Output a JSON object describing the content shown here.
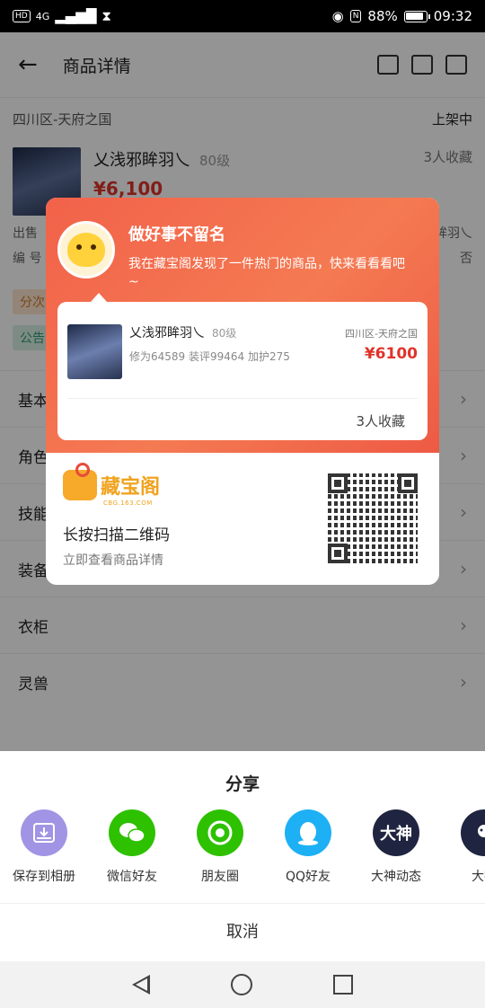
{
  "status_bar": {
    "network": "4G",
    "battery": "88%",
    "time": "09:32"
  },
  "background_page": {
    "title": "商品详情",
    "region": "四川区-天府之国",
    "listing_status": "上架中",
    "item": {
      "name": "乂浅邪眸羽乀",
      "level": "80级",
      "favorites": "3人收藏",
      "price": "¥6,100"
    },
    "info_left": [
      "出售",
      "编  号"
    ],
    "info_right": [
      "眸羽乀",
      "否"
    ],
    "tags": [
      "分次",
      "公告"
    ],
    "sections": [
      "基本",
      "角色",
      "技能",
      "装备物品",
      "衣柜",
      "灵兽"
    ]
  },
  "share_card": {
    "headline": "做好事不留名",
    "message": "我在藏宝阁发现了一件热门的商品，快来看看看吧~",
    "item": {
      "name": "乂浅邪眸羽乀",
      "level": "80级",
      "region": "四川区-天府之国",
      "stats": "修为64589  装评99464  加护275",
      "price": "¥6100",
      "favorites": "3人收藏"
    },
    "brand": "藏宝阁",
    "brand_sub": "CBG.163.COM",
    "scan_text": "长按扫描二维码",
    "scan_sub": "立即查看商品详情"
  },
  "share_sheet": {
    "title": "分享",
    "targets": [
      {
        "label": "保存到相册",
        "icon": "save-album-icon",
        "color": "#9d8fe0"
      },
      {
        "label": "微信好友",
        "icon": "wechat-icon",
        "color": "#2dc100"
      },
      {
        "label": "朋友圈",
        "icon": "moments-icon",
        "color": "#2dc100"
      },
      {
        "label": "QQ好友",
        "icon": "qq-icon",
        "color": "#1eb0f5"
      },
      {
        "label": "大神动态",
        "icon": "dashen-icon",
        "color": "#1f2540",
        "text": "大神"
      },
      {
        "label": "大神",
        "icon": "dashen-friend-icon",
        "color": "#1f2540"
      }
    ],
    "cancel": "取消"
  }
}
